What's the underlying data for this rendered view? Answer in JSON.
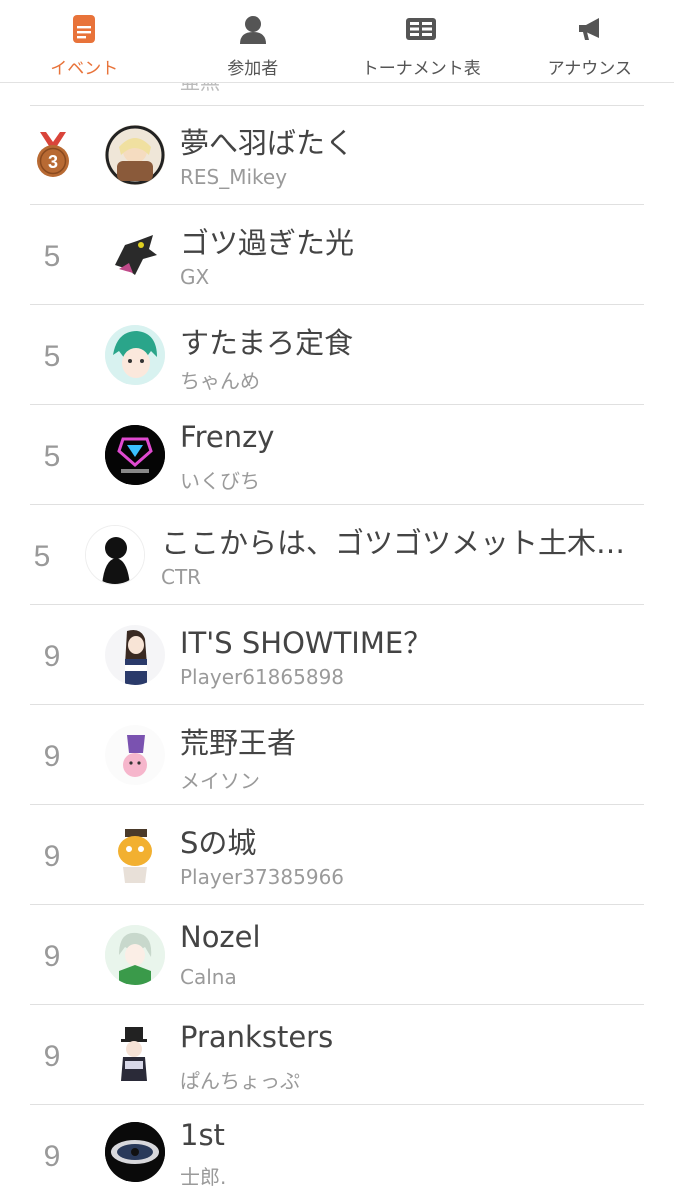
{
  "tabs": [
    {
      "label": "イベント",
      "icon": "event-icon",
      "active": true
    },
    {
      "label": "参加者",
      "icon": "person-icon",
      "active": false
    },
    {
      "label": "トーナメント表",
      "icon": "bracket-icon",
      "active": false
    },
    {
      "label": "アナウンス",
      "icon": "megaphone-icon",
      "active": false
    }
  ],
  "colors": {
    "accent": "#e8733a",
    "medal_bronze": "#b86a33"
  },
  "partial_row": {
    "sub": "亜無"
  },
  "rows": [
    {
      "rank": "3",
      "medal": "bronze",
      "team": "夢へ羽ばたく",
      "player": "RES_Mikey"
    },
    {
      "rank": "5",
      "team": "ゴツ過ぎた光",
      "player": "GX"
    },
    {
      "rank": "5",
      "team": "すたまろ定食",
      "player": "ちゃんめ"
    },
    {
      "rank": "5",
      "team": "Frenzy",
      "player": "いくびち"
    },
    {
      "rank": "5",
      "team": "ここからは、ゴツゴツメット土木…",
      "player": "CTR"
    },
    {
      "rank": "9",
      "team": "IT'S SHOWTIME？",
      "player": "Player61865898"
    },
    {
      "rank": "9",
      "team": "荒野王者",
      "player": "メイソン"
    },
    {
      "rank": "9",
      "team": "Sの城",
      "player": "Player37385966"
    },
    {
      "rank": "9",
      "team": "Nozel",
      "player": "Calna"
    },
    {
      "rank": "9",
      "team": "Pranksters",
      "player": "ぱんちょっぷ"
    },
    {
      "rank": "9",
      "team": "1st",
      "player": "士郎."
    }
  ]
}
